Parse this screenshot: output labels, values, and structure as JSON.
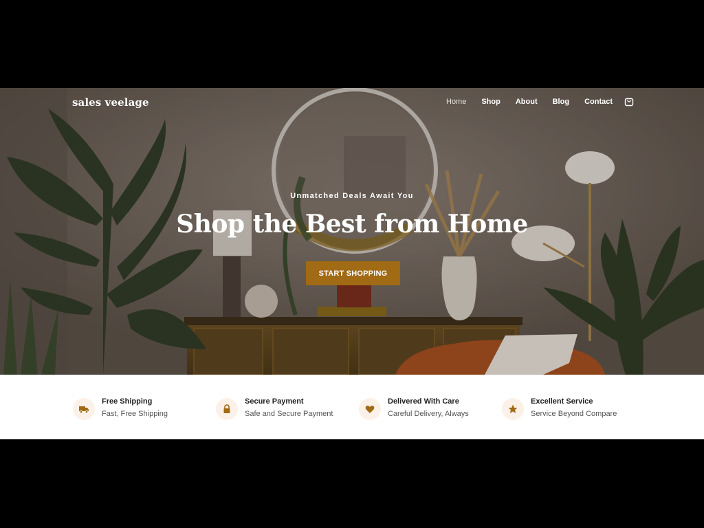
{
  "nav": {
    "logo": "sales veelage",
    "items": [
      {
        "label": "Home",
        "active": true
      },
      {
        "label": "Shop"
      },
      {
        "label": "About"
      },
      {
        "label": "Blog"
      },
      {
        "label": "Contact"
      }
    ],
    "cart_icon": "shopping-bag-icon"
  },
  "hero": {
    "eyebrow": "Unmatched Deals Await You",
    "headline": "Shop the Best from Home",
    "cta_label": "START SHOPPING"
  },
  "features": [
    {
      "icon": "truck-icon",
      "title": "Free Shipping",
      "subtitle": "Fast, Free Shipping"
    },
    {
      "icon": "lock-icon",
      "title": "Secure Payment",
      "subtitle": "Safe and Secure Payment"
    },
    {
      "icon": "heart-icon",
      "title": "Delivered With Care",
      "subtitle": "Careful Delivery, Always"
    },
    {
      "icon": "star-icon",
      "title": "Excellent Service",
      "subtitle": "Service Beyond Compare"
    }
  ],
  "colors": {
    "accent": "#a16a14",
    "icon_bg": "#fbf1e8",
    "icon_fg": "#a16a14"
  }
}
